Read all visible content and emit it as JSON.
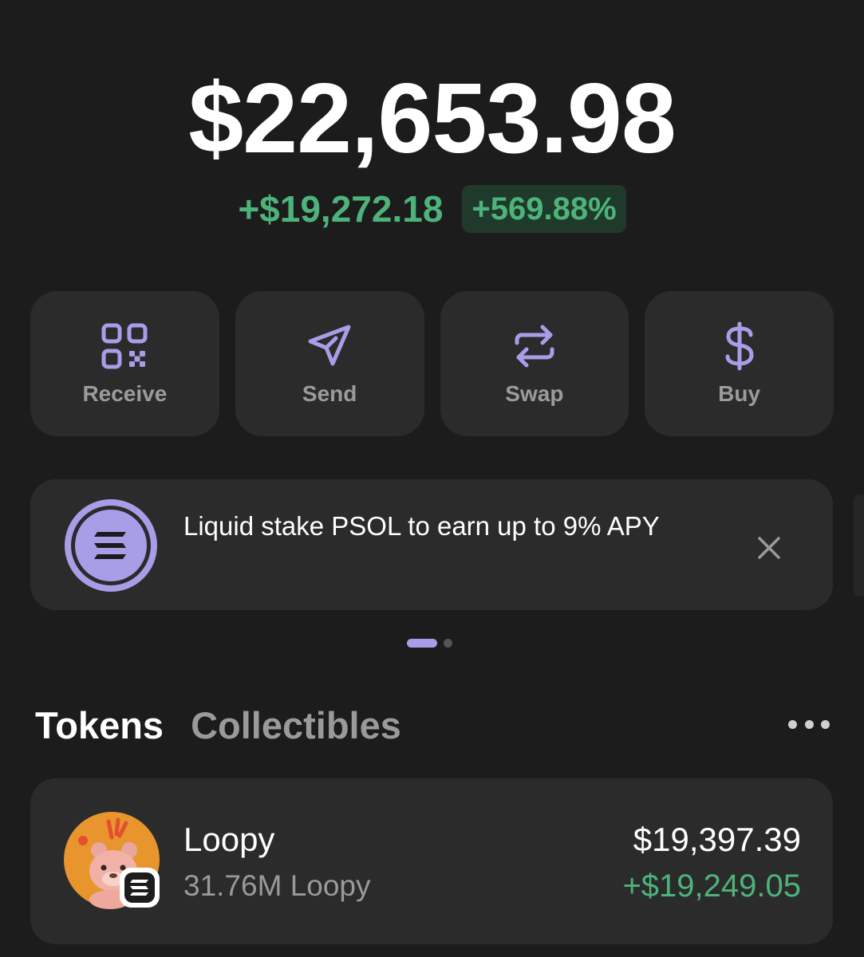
{
  "portfolio": {
    "balance": "$22,653.98",
    "change_amount": "+$19,272.18",
    "change_percent": "+569.88%"
  },
  "actions": [
    {
      "label": "Receive",
      "icon": "qr-code-icon"
    },
    {
      "label": "Send",
      "icon": "send-icon"
    },
    {
      "label": "Swap",
      "icon": "swap-icon"
    },
    {
      "label": "Buy",
      "icon": "dollar-icon"
    }
  ],
  "promo": {
    "text": "Liquid stake PSOL to earn up to 9% APY",
    "icon": "solana-icon",
    "close_icon": "close-icon"
  },
  "pager": {
    "pages": 2,
    "active": 1
  },
  "tabs": [
    {
      "label": "Tokens",
      "active": true
    },
    {
      "label": "Collectibles",
      "active": false
    }
  ],
  "more_icon": "more-icon",
  "tokens": [
    {
      "name": "Loopy",
      "amount": "31.76M Loopy",
      "value": "$19,397.39",
      "change": "+$19,249.05",
      "icon": "loopy-avatar",
      "chain_badge": "solana-badge-icon"
    }
  ],
  "colors": {
    "background": "#1c1c1c",
    "card": "#2b2b2b",
    "accent": "#a89ee8",
    "positive": "#4db37a",
    "positive_bg": "#1f3a2a",
    "muted_text": "#9a9a9a"
  }
}
